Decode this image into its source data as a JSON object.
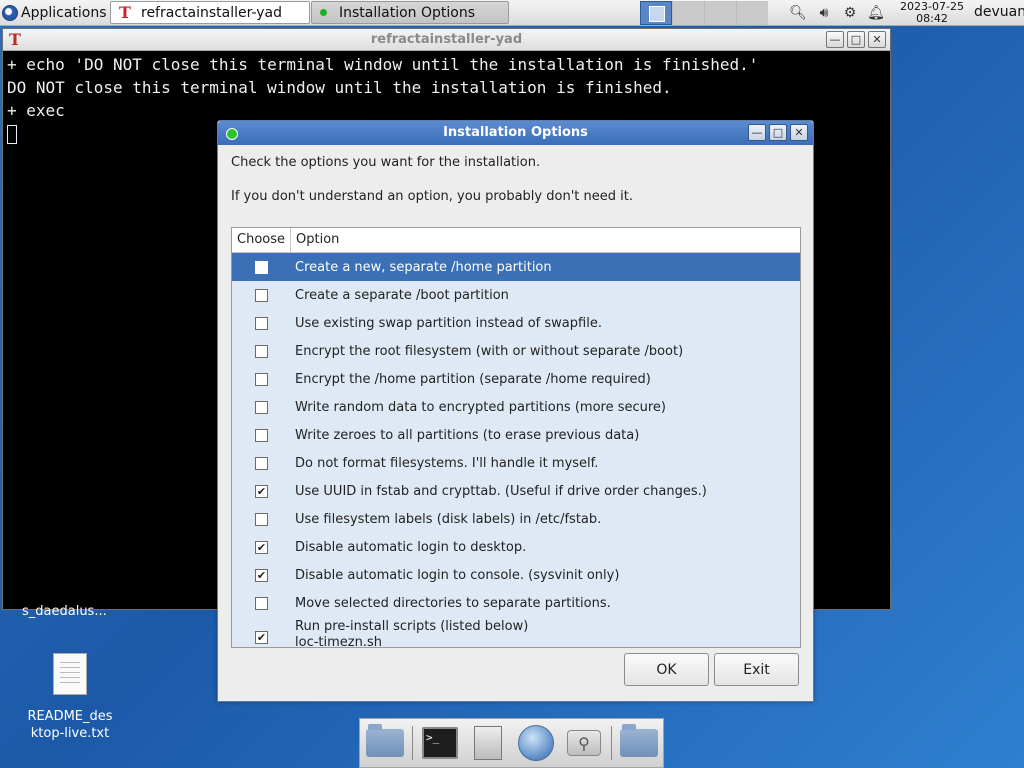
{
  "top_panel": {
    "apps_label": "Applications",
    "tasks": [
      {
        "label": "refractainstaller-yad",
        "icon": "refracta-t-icon"
      },
      {
        "label": "Installation Options",
        "icon": "green-dot-icon"
      }
    ],
    "clock": {
      "date": "2023-07-25",
      "time": "08:42"
    },
    "user": "devuan",
    "tray_icons": [
      "search-icon",
      "volume-icon",
      "network-icon",
      "bell-icon"
    ]
  },
  "terminal": {
    "title": "refractainstaller-yad",
    "lines": [
      "+ echo 'DO NOT close this terminal window until the installation is finished.'",
      "DO NOT close this terminal window until the installation is finished.",
      "+ exec"
    ]
  },
  "desktop": {
    "partial_label": "s_daedalus...",
    "readme_label_1": "README_des",
    "readme_label_2": "ktop-live.txt"
  },
  "dialog": {
    "title": "Installation Options",
    "text_1": "Check the options you want for the installation.",
    "text_2": "If you don't understand an option, you probably don't need it.",
    "columns": {
      "choose": "Choose",
      "option": "Option"
    },
    "options": [
      {
        "label": "Create a new, separate /home partition",
        "checked": false,
        "selected": true
      },
      {
        "label": "Create a separate /boot partition",
        "checked": false
      },
      {
        "label": "Use existing swap partition instead of swapfile.",
        "checked": false
      },
      {
        "label": "Encrypt the root filesystem (with or without separate /boot)",
        "checked": false
      },
      {
        "label": "Encrypt the /home partition (separate /home required)",
        "checked": false
      },
      {
        "label": "Write random data to encrypted partitions (more secure)",
        "checked": false
      },
      {
        "label": "Write zeroes to all partitions (to erase previous data)",
        "checked": false
      },
      {
        "label": "Do not format filesystems. I'll handle it myself.",
        "checked": false
      },
      {
        "label": "Use UUID in fstab and crypttab. (Useful if drive order changes.)",
        "checked": true
      },
      {
        "label": "Use filesystem labels (disk labels) in /etc/fstab.",
        "checked": false
      },
      {
        "label": "Disable automatic login to desktop.",
        "checked": true
      },
      {
        "label": "Disable automatic login to console. (sysvinit only)",
        "checked": true
      },
      {
        "label": "Move selected directories to separate partitions.",
        "checked": false
      },
      {
        "label": "Run pre-install scripts (listed below)",
        "sublabel": "loc-timezn.sh",
        "checked": true
      }
    ],
    "ok_label": "OK",
    "exit_label": "Exit"
  },
  "colors": {
    "selection": "#3b6fb6",
    "row_bg": "#dfe9f5",
    "titlebar": "#3a6db9",
    "desktop": "#1c5aa8"
  }
}
